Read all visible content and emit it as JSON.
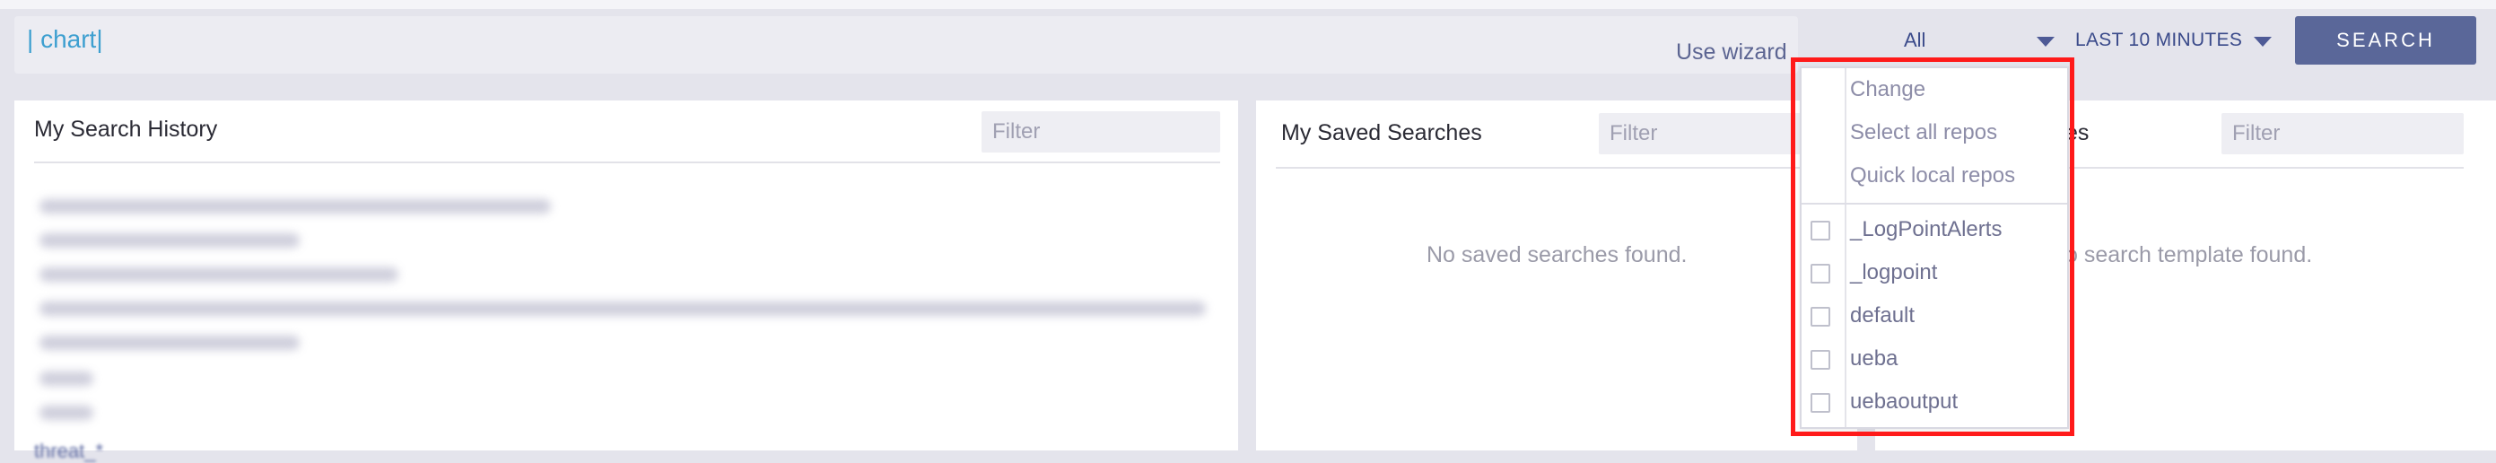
{
  "search": {
    "query": "chart",
    "use_wizard": "Use wizard",
    "repo_value": "All",
    "time_range": "LAST 10 MINUTES",
    "search_button": "SEARCH"
  },
  "history": {
    "title": "My Search History",
    "filter_placeholder": "Filter",
    "last_item_label": "threat_*"
  },
  "saved": {
    "title": "My Saved Searches",
    "filter_placeholder": "Filter",
    "empty": "No saved searches found."
  },
  "templates": {
    "title_partial": "es",
    "filter_placeholder": "Filter",
    "empty_partial": "o search template found."
  },
  "repo_dropdown": {
    "actions": [
      "Change",
      "Select all repos",
      "Quick local repos"
    ],
    "repos": [
      "_LogPointAlerts",
      "_logpoint",
      "default",
      "ueba",
      "uebaoutput"
    ]
  },
  "colors": {
    "accent": "#5a6799",
    "query": "#3d9fd0",
    "highlight": "#ff1a1a"
  }
}
